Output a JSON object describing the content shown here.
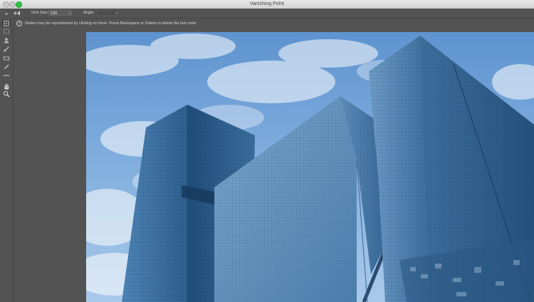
{
  "window": {
    "title": "Vanishing Point"
  },
  "options": {
    "grid_size_label": "Grid Size:",
    "grid_size_value": "100",
    "angle_label": "Angle:",
    "angle_value": ""
  },
  "info": {
    "message": "Nodes may be repositioned by clicking on them.  Press Backspace or Delete to delete the last node."
  },
  "tools": [
    {
      "name": "edit-plane-tool",
      "icon": "edit-plane-icon"
    },
    {
      "name": "create-plane-tool",
      "icon": "create-plane-icon"
    },
    {
      "name": "marquee-tool",
      "icon": "marquee-icon"
    },
    {
      "name": "stamp-tool",
      "icon": "stamp-icon"
    },
    {
      "name": "brush-tool",
      "icon": "brush-icon"
    },
    {
      "name": "transform-tool",
      "icon": "transform-icon"
    },
    {
      "name": "eyedropper-tool",
      "icon": "eyedropper-icon"
    },
    {
      "name": "measure-tool",
      "icon": "measure-icon"
    },
    {
      "name": "hand-tool",
      "icon": "hand-icon"
    },
    {
      "name": "zoom-tool",
      "icon": "zoom-icon"
    }
  ],
  "canvas": {
    "subject": "glass-skyscrapers-photo"
  }
}
